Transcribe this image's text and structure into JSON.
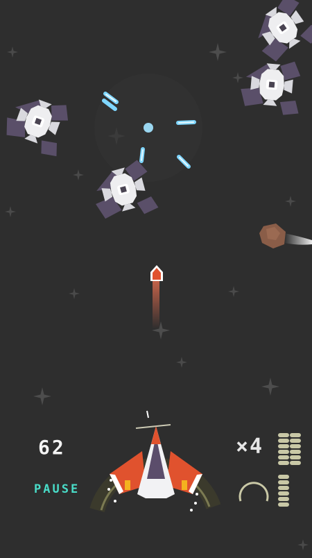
{
  "hud": {
    "score": "62",
    "pause_label": "PAUSE",
    "multiplier": "×4"
  },
  "ammo": {
    "reserve_columns": 2,
    "reserve_rows": 8,
    "magazine_rows": 7
  },
  "enemies_visible": 4,
  "colors": {
    "background": "#2e2e2e",
    "accent": "#49dcc8",
    "laser": "#7fd6ff",
    "player_red": "#e0522e",
    "shield_ring": "#7b7a52",
    "ammo": "#c9c8a6"
  },
  "icons": [
    "player-ship-icon",
    "enemy-ship-icon",
    "asteroid-icon",
    "rocket-icon",
    "laser-bolt-icon",
    "star-icon",
    "reload-arc-icon",
    "ammo-pill-icon"
  ]
}
